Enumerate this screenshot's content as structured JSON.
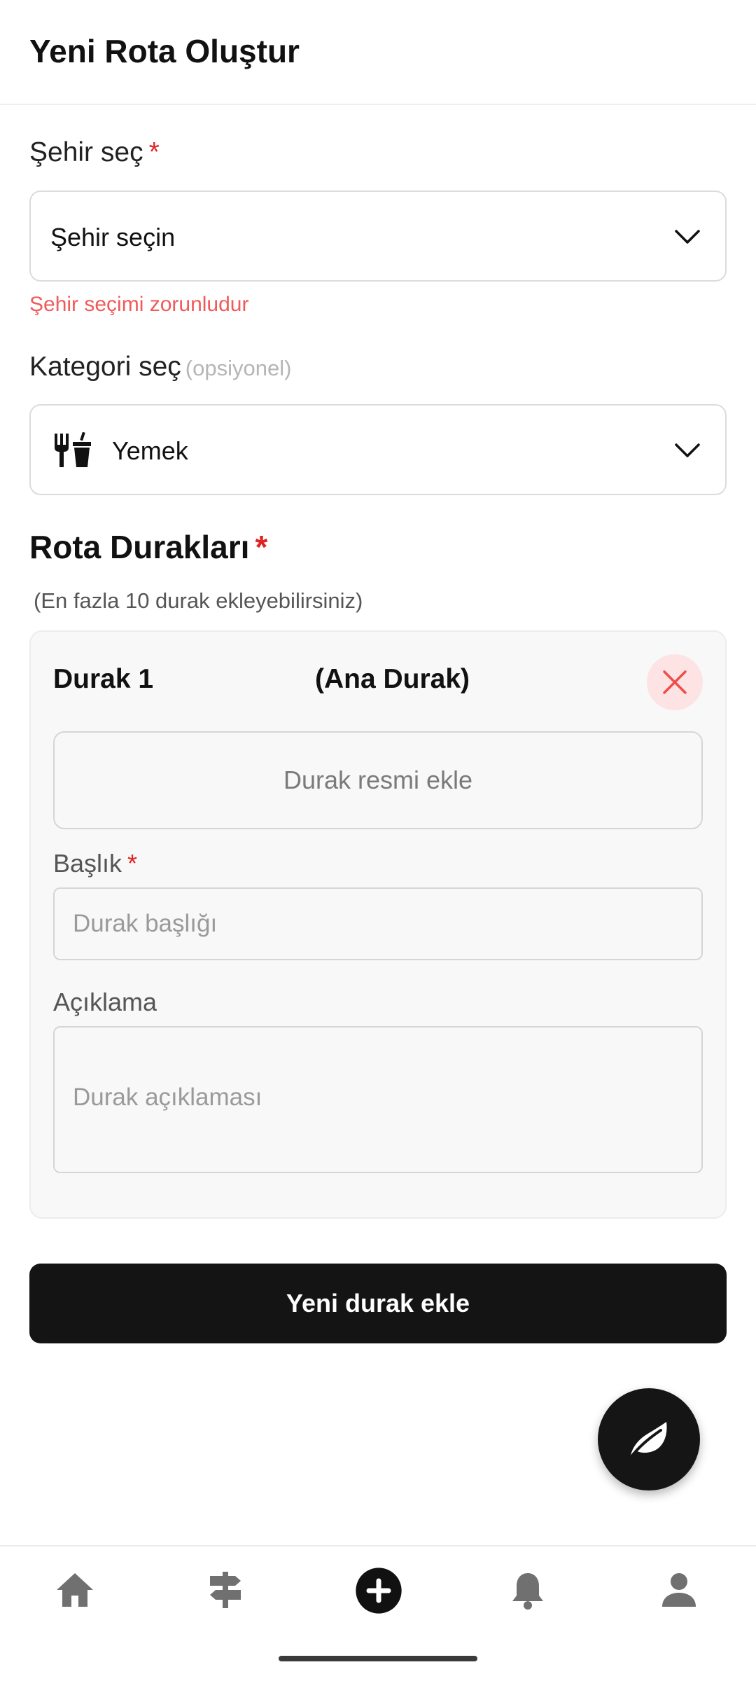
{
  "header": {
    "title": "Yeni Rota Oluştur"
  },
  "city": {
    "label": "Şehir seç",
    "required_mark": "*",
    "selected": "Şehir seçin",
    "error": "Şehir seçimi zorunludur",
    "icon": "chevron-down-icon"
  },
  "category": {
    "label": "Kategori seç",
    "optional_note": "(opsiyonel)",
    "selected": "Yemek",
    "selected_icon": "fork-and-drink-icon",
    "icon": "chevron-down-icon"
  },
  "stops_section": {
    "title": "Rota Durakları",
    "required_mark": "*",
    "hint": "(En fazla 10 durak ekleyebilirsiniz)"
  },
  "stop": {
    "title": "Durak 1",
    "main_label": "(Ana Durak)",
    "remove_icon": "close-icon",
    "image_button": "Durak resmi ekle",
    "title_label": "Başlık",
    "title_required_mark": "*",
    "title_placeholder": "Durak başlığı",
    "title_value": "",
    "desc_label": "Açıklama",
    "desc_placeholder": "Durak açıklaması",
    "desc_value": ""
  },
  "add_stop_button": "Yeni durak ekle",
  "fab": {
    "icon": "leaf-icon"
  },
  "bottom_nav": [
    {
      "name": "home",
      "icon": "home-icon"
    },
    {
      "name": "routes",
      "icon": "signpost-icon"
    },
    {
      "name": "create",
      "icon": "plus-circle-icon"
    },
    {
      "name": "notifications",
      "icon": "bell-icon"
    },
    {
      "name": "profile",
      "icon": "person-icon"
    }
  ],
  "colors": {
    "accent": "#141414",
    "required": "#e02424",
    "error": "#f05a5a",
    "remove_bg": "#fde3e3",
    "nav_icon": "#707070"
  }
}
